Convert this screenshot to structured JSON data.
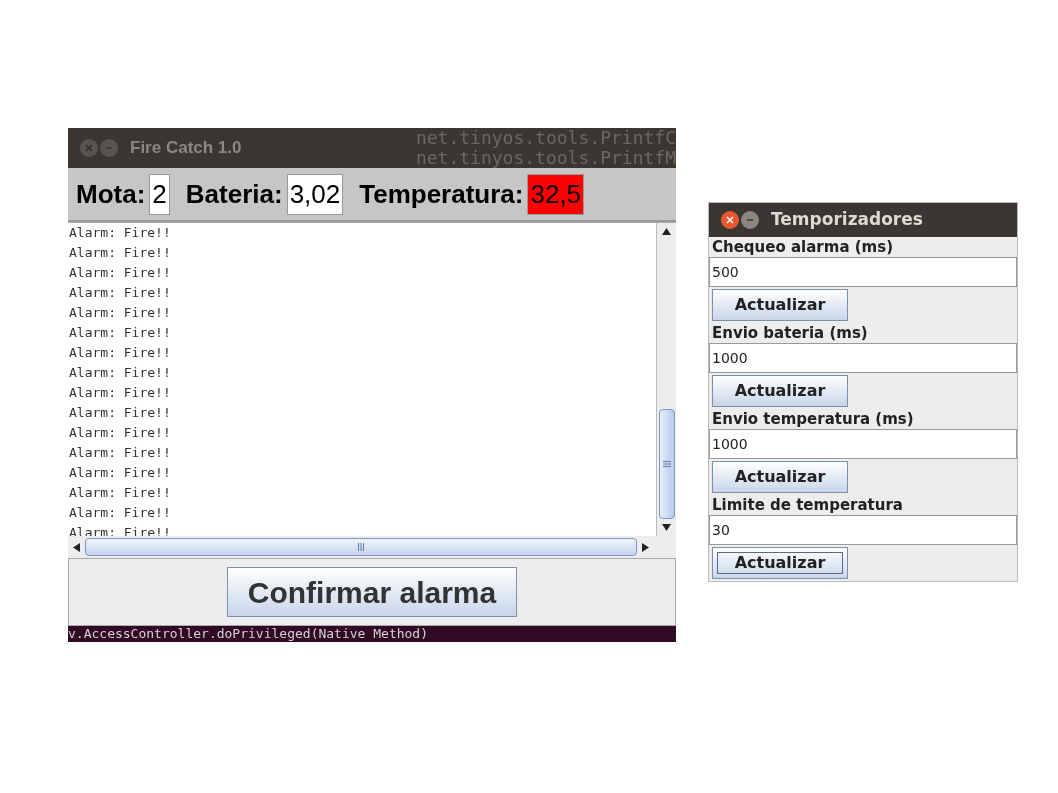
{
  "terminal": {
    "top_lines": [
      "net.tinyos.tools.PrintfC",
      "net.tinyos.tools.PrintfM"
    ],
    "bottom_line": "v.AccessController.doPrivileged(Native Method)"
  },
  "main_window": {
    "title": "Fire Catch 1.0",
    "readings": [
      {
        "label": "Mota:",
        "value": "2",
        "alert": false
      },
      {
        "label": "Bateria:",
        "value": "3,02",
        "alert": false
      },
      {
        "label": "Temperatura:",
        "value": "32,5",
        "alert": true
      }
    ],
    "log": [
      "Alarm: Fire!!",
      "Alarm: Fire!!",
      "Alarm: Fire!!",
      "Alarm: Fire!!",
      "Alarm: Fire!!",
      "Alarm: Fire!!",
      "Alarm: Fire!!",
      "Alarm: Fire!!",
      "Alarm: Fire!!",
      "Alarm: Fire!!",
      "Alarm: Fire!!",
      "Alarm: Fire!!",
      "Alarm: Fire!!",
      "Alarm: Fire!!",
      "Alarm: Fire!!",
      "Alarm: Fire!!"
    ],
    "button": "Confirmar alarma"
  },
  "timers_window": {
    "title": "Temporizadores",
    "settings": [
      {
        "label": "Chequeo alarma (ms)",
        "value": "500",
        "button": "Actualizar",
        "focused": false
      },
      {
        "label": "Envio bateria (ms)",
        "value": "1000",
        "button": "Actualizar",
        "focused": false
      },
      {
        "label": "Envio temperatura (ms)",
        "value": "1000",
        "button": "Actualizar",
        "focused": false
      },
      {
        "label": "Limite de temperatura",
        "value": "30",
        "button": "Actualizar",
        "focused": true
      }
    ]
  }
}
